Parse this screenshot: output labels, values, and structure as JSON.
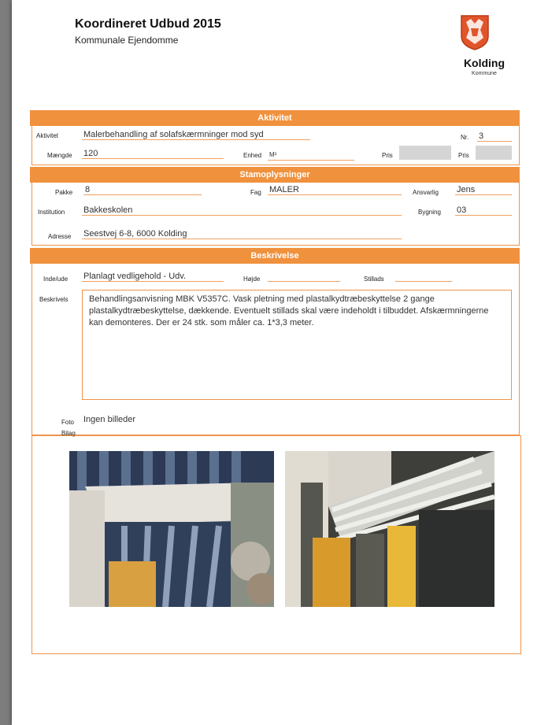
{
  "header": {
    "title": "Koordineret Udbud 2015",
    "subtitle": "Kommunale Ejendomme"
  },
  "logo": {
    "name": "Kolding",
    "sub": "Kommune"
  },
  "aktivitet": {
    "band": "Aktivitet",
    "aktivitet_label": "Aktivitet",
    "aktivitet_value": "Malerbehandling af solafskærmninger mod syd",
    "nr_label": "Nr.",
    "nr_value": "3",
    "maengde_label": "Mængde",
    "maengde_value": "120",
    "enhed_label": "Enhed",
    "enhed_value": "M²",
    "pris1_label": "Pris",
    "pris2_label": "Pris"
  },
  "stamoplysninger": {
    "band": "Stamoplysninger",
    "pakke_label": "Pakke",
    "pakke_value": "8",
    "fag_label": "Fag",
    "fag_value": "MALER",
    "ansvarlig_label": "Ansvarlig",
    "ansvarlig_value": "Jens",
    "institution_label": "Institution",
    "institution_value": "Bakkeskolen",
    "bygning_label": "Bygning",
    "bygning_value": "03",
    "adresse_label": "Adresse",
    "adresse_value": "Seestvej 6-8, 6000 Kolding"
  },
  "beskrivelse": {
    "band": "Beskrivelse",
    "indeude_label": "Inde/ude",
    "indeude_value": "Planlagt vedligehold - Udv.",
    "hojde_label": "Højde",
    "stillads_label": "Stillads",
    "beskrivelse_label": "Beskrivels",
    "text": "Behandlingsanvisning MBK V5357C. Vask pletning med plastalkydtræbeskyttelse 2 gange plastalkydtræbeskyttelse, dækkende. Eventuelt stillads skal være indeholdt i tilbuddet. Afskærmningerne kan demonteres. Der er 24 stk. som måler ca. 1*3,3 meter.",
    "foto_label": "Foto",
    "foto_value": "Ingen billeder",
    "bilag_label": "Bilag"
  },
  "colors": {
    "accent": "#f0913d",
    "border": "#f0944a",
    "gray_box": "#d5d5d5"
  }
}
